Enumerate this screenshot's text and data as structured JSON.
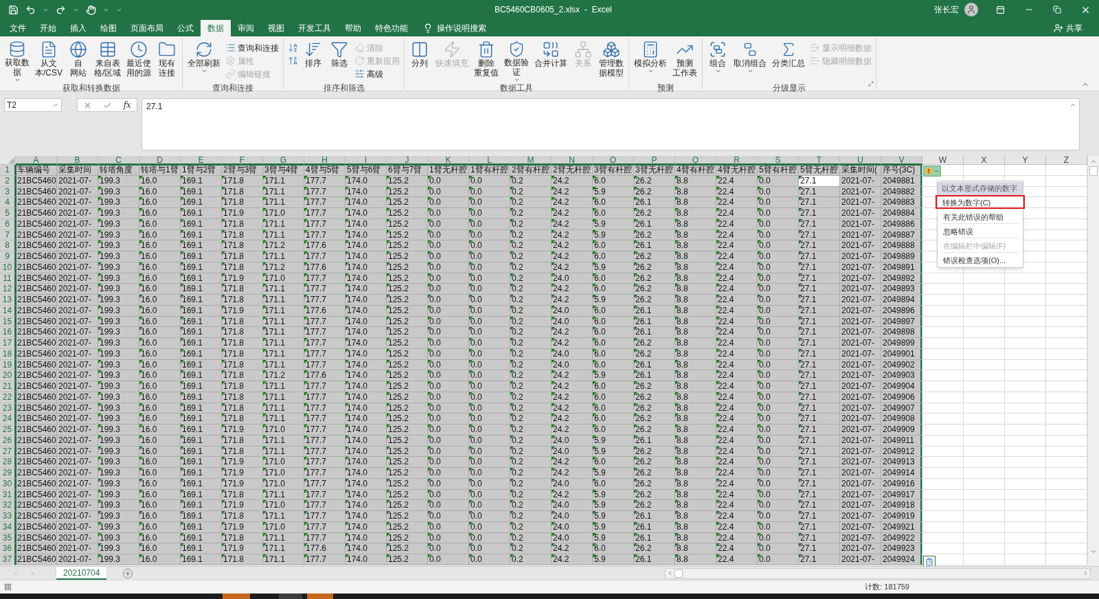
{
  "title_bar": {
    "file_title": "BC5460CB0605_2.xlsx  -  Excel",
    "user": "张长宏"
  },
  "ribbon_tabs": [
    {
      "label": "文件",
      "selected": false
    },
    {
      "label": "开始",
      "selected": false
    },
    {
      "label": "插入",
      "selected": false
    },
    {
      "label": "绘图",
      "selected": false
    },
    {
      "label": "页面布局",
      "selected": false
    },
    {
      "label": "公式",
      "selected": false
    },
    {
      "label": "数据",
      "selected": true
    },
    {
      "label": "审阅",
      "selected": false
    },
    {
      "label": "视图",
      "selected": false
    },
    {
      "label": "开发工具",
      "selected": false
    },
    {
      "label": "帮助",
      "selected": false
    },
    {
      "label": "特色功能",
      "selected": false
    }
  ],
  "tell_me": "操作说明搜索",
  "share": "共享",
  "ribbon_groups": [
    {
      "label": "获取和转换数据",
      "launcher": false,
      "buttons": [
        {
          "kind": "large",
          "lines": [
            "获取数",
            "据"
          ],
          "dropdown": true,
          "disabled": false
        },
        {
          "kind": "large",
          "lines": [
            "从文",
            "本/CSV"
          ],
          "dropdown": false,
          "disabled": false
        },
        {
          "kind": "large",
          "lines": [
            "自",
            "网站"
          ],
          "dropdown": false,
          "disabled": false
        },
        {
          "kind": "large",
          "lines": [
            "来自表",
            "格/区域"
          ],
          "dropdown": false,
          "disabled": false
        },
        {
          "kind": "large",
          "lines": [
            "最近使",
            "用的源"
          ],
          "dropdown": false,
          "disabled": false
        },
        {
          "kind": "large",
          "lines": [
            "现有",
            "连接"
          ],
          "dropdown": false,
          "disabled": false
        }
      ]
    },
    {
      "label": "查询和连接",
      "launcher": false,
      "buttons": [
        {
          "kind": "large",
          "lines": [
            "全部刷新"
          ],
          "dropdown": true,
          "disabled": false
        },
        {
          "kind": "small",
          "lines": [
            "查询和连接"
          ],
          "dropdown": false,
          "disabled": false
        },
        {
          "kind": "small",
          "lines": [
            "属性"
          ],
          "dropdown": false,
          "disabled": true
        },
        {
          "kind": "small",
          "lines": [
            "编辑链接"
          ],
          "dropdown": false,
          "disabled": true
        }
      ]
    },
    {
      "label": "排序和筛选",
      "launcher": false,
      "buttons": [
        {
          "kind": "small",
          "dropdown": false,
          "disabled": false
        },
        {
          "kind": "small",
          "dropdown": false,
          "disabled": false
        },
        {
          "kind": "large",
          "lines": [
            "排序"
          ],
          "dropdown": false,
          "disabled": false
        },
        {
          "kind": "large",
          "lines": [
            "筛选"
          ],
          "dropdown": false,
          "disabled": false
        },
        {
          "kind": "small",
          "lines": [
            "清除"
          ],
          "dropdown": false,
          "disabled": true
        },
        {
          "kind": "small",
          "lines": [
            "重新应用"
          ],
          "dropdown": false,
          "disabled": true
        },
        {
          "kind": "small",
          "lines": [
            "高级"
          ],
          "dropdown": false,
          "disabled": false
        }
      ]
    },
    {
      "label": "数据工具",
      "launcher": false,
      "buttons": [
        {
          "kind": "large",
          "lines": [
            "分列"
          ],
          "dropdown": false,
          "disabled": false
        },
        {
          "kind": "large",
          "lines": [
            "快速填充"
          ],
          "dropdown": false,
          "disabled": true
        },
        {
          "kind": "large",
          "lines": [
            "删除",
            "重复值"
          ],
          "dropdown": false,
          "disabled": false
        },
        {
          "kind": "large",
          "lines": [
            "数据验",
            "证"
          ],
          "dropdown": true,
          "disabled": false
        },
        {
          "kind": "large",
          "lines": [
            "合并计算"
          ],
          "dropdown": false,
          "disabled": false
        },
        {
          "kind": "large",
          "lines": [
            "关系"
          ],
          "dropdown": false,
          "disabled": true
        },
        {
          "kind": "large",
          "lines": [
            "管理数",
            "据模型"
          ],
          "dropdown": false,
          "disabled": false
        }
      ]
    },
    {
      "label": "预测",
      "launcher": false,
      "buttons": [
        {
          "kind": "large",
          "lines": [
            "模拟分析"
          ],
          "dropdown": true,
          "disabled": false
        },
        {
          "kind": "large",
          "lines": [
            "预测",
            "工作表"
          ],
          "dropdown": false,
          "disabled": false
        }
      ]
    },
    {
      "label": "分级显示",
      "launcher": true,
      "buttons": [
        {
          "kind": "large",
          "lines": [
            "组合"
          ],
          "dropdown": true,
          "disabled": false
        },
        {
          "kind": "large",
          "lines": [
            "取消组合"
          ],
          "dropdown": true,
          "disabled": false
        },
        {
          "kind": "large",
          "lines": [
            "分类汇总"
          ],
          "dropdown": false,
          "disabled": false
        },
        {
          "kind": "small",
          "lines": [
            "显示明细数据"
          ],
          "dropdown": false,
          "disabled": true
        },
        {
          "kind": "small",
          "lines": [
            "隐藏明细数据"
          ],
          "dropdown": false,
          "disabled": true
        }
      ]
    }
  ],
  "formula_bar": {
    "name_box": "T2",
    "function_button": "fx",
    "value": "27.1"
  },
  "grid": {
    "columns": [
      {
        "letter": "A",
        "selected": true,
        "flagged": false
      },
      {
        "letter": "B",
        "selected": true,
        "flagged": false
      },
      {
        "letter": "C",
        "selected": true,
        "flagged": true
      },
      {
        "letter": "D",
        "selected": true,
        "flagged": true
      },
      {
        "letter": "E",
        "selected": true,
        "flagged": true
      },
      {
        "letter": "F",
        "selected": true,
        "flagged": true
      },
      {
        "letter": "G",
        "selected": true,
        "flagged": true
      },
      {
        "letter": "H",
        "selected": true,
        "flagged": true
      },
      {
        "letter": "I",
        "selected": true,
        "flagged": true
      },
      {
        "letter": "J",
        "selected": true,
        "flagged": true
      },
      {
        "letter": "K",
        "selected": true,
        "flagged": true
      },
      {
        "letter": "L",
        "selected": true,
        "flagged": true
      },
      {
        "letter": "M",
        "selected": true,
        "flagged": true
      },
      {
        "letter": "N",
        "selected": true,
        "flagged": true
      },
      {
        "letter": "O",
        "selected": true,
        "flagged": true
      },
      {
        "letter": "P",
        "selected": true,
        "flagged": true
      },
      {
        "letter": "Q",
        "selected": true,
        "flagged": true
      },
      {
        "letter": "R",
        "selected": true,
        "flagged": true
      },
      {
        "letter": "S",
        "selected": true,
        "flagged": true
      },
      {
        "letter": "T",
        "selected": true,
        "flagged": true
      },
      {
        "letter": "U",
        "selected": true,
        "flagged": false
      },
      {
        "letter": "V",
        "selected": true,
        "flagged": false
      },
      {
        "letter": "W",
        "selected": false,
        "flagged": false
      },
      {
        "letter": "X",
        "selected": false,
        "flagged": false
      },
      {
        "letter": "Y",
        "selected": false,
        "flagged": false
      },
      {
        "letter": "Z",
        "selected": false,
        "flagged": false
      }
    ],
    "rows": [
      {
        "number": "1",
        "kind": "header",
        "selected": true,
        "cells": [
          "车辆编号",
          "采集时间",
          "转塔角度",
          "转塔与1臂",
          "1臂与2臂",
          "2臂与3臂",
          "3臂与4臂",
          "4臂与5臂",
          "5臂与6臂",
          "6臂与7臂",
          "1臂无杆腔",
          "1臂有杆腔",
          "2臂有杆腔",
          "2臂无杆腔",
          "3臂有杆腔",
          "3臂无杆腔",
          "4臂有杆腔",
          "4臂无杆腔",
          "5臂有杆腔",
          "5臂无杆腔",
          "采集时间(",
          "序号(3C)"
        ]
      },
      {
        "number": "2",
        "kind": "data",
        "selected": true,
        "cells": [
          "21BC5460",
          "2021-07-",
          "199.3",
          "16.0",
          "169.1",
          "171.8",
          "171.1",
          "177.7",
          "174.0",
          "125.2",
          "0.0",
          "0.0",
          "0.2",
          "24.2",
          "6.0",
          "26.2",
          "8.8",
          "22.4",
          "0.0",
          {
            "text": "27.1",
            "active": true
          },
          "2021-07-",
          "2049881"
        ]
      },
      {
        "number": "3",
        "kind": "data",
        "selected": true,
        "cells": [
          "21BC5460",
          "2021-07-",
          "199.3",
          "16.0",
          "169.1",
          "171.8",
          "171.1",
          "177.7",
          "174.0",
          "125.2",
          "0.0",
          "0.0",
          "0.2",
          "24.2",
          "5.9",
          "26.2",
          "8.8",
          "22.4",
          "0.0",
          "27.1",
          "2021-07-",
          "2049882"
        ]
      },
      {
        "number": "4",
        "kind": "data",
        "selected": true,
        "cells": [
          "21BC5460",
          "2021-07-",
          "199.3",
          "16.0",
          "169.1",
          "171.8",
          "171.1",
          "177.7",
          "174.0",
          "125.2",
          "0.0",
          "0.0",
          "0.2",
          "24.2",
          "6.0",
          "26.1",
          "8.8",
          "22.4",
          "0.0",
          "27.1",
          "2021-07-",
          "2049883"
        ]
      },
      {
        "number": "5",
        "kind": "data",
        "selected": true,
        "cells": [
          "21BC5460",
          "2021-07-",
          "199.3",
          "16.0",
          "169.1",
          "171.9",
          "171.0",
          "177.7",
          "174.0",
          "125.2",
          "0.0",
          "0.0",
          "0.2",
          "24.2",
          "6.0",
          "26.2",
          "8.8",
          "22.4",
          "0.0",
          "27.1",
          "2021-07-",
          "2049884"
        ]
      },
      {
        "number": "6",
        "kind": "data",
        "selected": true,
        "cells": [
          "21BC5460",
          "2021-07-",
          "199.3",
          "16.0",
          "169.1",
          "171.8",
          "171.1",
          "177.7",
          "174.0",
          "125.2",
          "0.0",
          "0.0",
          "0.2",
          "24.2",
          "5.9",
          "26.1",
          "8.8",
          "22.4",
          "0.0",
          "27.1",
          "2021-07-",
          "2049886"
        ]
      },
      {
        "number": "7",
        "kind": "data",
        "selected": true,
        "cells": [
          "21BC5460",
          "2021-07-",
          "199.3",
          "16.0",
          "169.1",
          "171.8",
          "171.1",
          "177.7",
          "174.0",
          "125.2",
          "0.0",
          "0.0",
          "0.2",
          "24.2",
          "5.9",
          "26.2",
          "8.8",
          "22.4",
          "0.0",
          "27.1",
          "2021-07-",
          "2049887"
        ]
      },
      {
        "number": "8",
        "kind": "data",
        "selected": true,
        "cells": [
          "21BC5460",
          "2021-07-",
          "199.3",
          "16.0",
          "169.1",
          "171.8",
          "171.2",
          "177.6",
          "174.0",
          "125.2",
          "0.0",
          "0.0",
          "0.2",
          "24.2",
          "6.0",
          "26.1",
          "8.8",
          "22.4",
          "0.0",
          "27.1",
          "2021-07-",
          "2049888"
        ]
      },
      {
        "number": "9",
        "kind": "data",
        "selected": true,
        "cells": [
          "21BC5460",
          "2021-07-",
          "199.3",
          "16.0",
          "169.1",
          "171.8",
          "171.1",
          "177.7",
          "174.0",
          "125.2",
          "0.0",
          "0.0",
          "0.2",
          "24.2",
          "6.0",
          "26.2",
          "8.8",
          "22.4",
          "0.0",
          "27.1",
          "2021-07-",
          "2049889"
        ]
      },
      {
        "number": "10",
        "kind": "data",
        "selected": true,
        "cells": [
          "21BC5460",
          "2021-07-",
          "199.3",
          "16.0",
          "169.1",
          "171.8",
          "171.2",
          "177.6",
          "174.0",
          "125.2",
          "0.0",
          "0.0",
          "0.2",
          "24.2",
          "5.9",
          "26.2",
          "8.8",
          "22.4",
          "0.0",
          "27.1",
          "2021-07-",
          "2049891"
        ]
      },
      {
        "number": "11",
        "kind": "data",
        "selected": true,
        "cells": [
          "21BC5460",
          "2021-07-",
          "199.3",
          "16.0",
          "169.1",
          "171.9",
          "171.0",
          "177.7",
          "174.0",
          "125.2",
          "0.0",
          "0.0",
          "0.2",
          "24.0",
          "6.0",
          "26.2",
          "8.8",
          "22.4",
          "0.0",
          "27.1",
          "2021-07-",
          "2049892"
        ]
      },
      {
        "number": "12",
        "kind": "data",
        "selected": true,
        "cells": [
          "21BC5460",
          "2021-07-",
          "199.3",
          "16.0",
          "169.1",
          "171.8",
          "171.1",
          "177.7",
          "174.0",
          "125.2",
          "0.0",
          "0.0",
          "0.2",
          "24.2",
          "6.0",
          "26.2",
          "8.8",
          "22.4",
          "0.0",
          "27.1",
          "2021-07-",
          "2049893"
        ]
      },
      {
        "number": "13",
        "kind": "data",
        "selected": true,
        "cells": [
          "21BC5460",
          "2021-07-",
          "199.3",
          "16.0",
          "169.1",
          "171.8",
          "171.1",
          "177.7",
          "174.0",
          "125.2",
          "0.0",
          "0.0",
          "0.2",
          "24.2",
          "5.9",
          "26.2",
          "8.8",
          "22.4",
          "0.0",
          "27.1",
          "2021-07-",
          "2049894"
        ]
      },
      {
        "number": "14",
        "kind": "data",
        "selected": true,
        "cells": [
          "21BC5460",
          "2021-07-",
          "199.3",
          "16.0",
          "169.1",
          "171.9",
          "171.1",
          "177.6",
          "174.0",
          "125.2",
          "0.0",
          "0.0",
          "0.2",
          "24.0",
          "6.0",
          "26.1",
          "8.8",
          "22.4",
          "0.0",
          "27.1",
          "2021-07-",
          "2049896"
        ]
      },
      {
        "number": "15",
        "kind": "data",
        "selected": true,
        "cells": [
          "21BC5460",
          "2021-07-",
          "199.3",
          "16.0",
          "169.1",
          "171.8",
          "171.1",
          "177.7",
          "174.0",
          "125.2",
          "0.0",
          "0.0",
          "0.2",
          "24.0",
          "6.0",
          "26.1",
          "8.8",
          "22.4",
          "0.0",
          "27.1",
          "2021-07-",
          "2049897"
        ]
      },
      {
        "number": "16",
        "kind": "data",
        "selected": true,
        "cells": [
          "21BC5460",
          "2021-07-",
          "199.3",
          "16.0",
          "169.1",
          "171.8",
          "171.1",
          "177.7",
          "174.0",
          "125.2",
          "0.0",
          "0.0",
          "0.2",
          "24.2",
          "6.0",
          "26.1",
          "8.8",
          "22.4",
          "0.0",
          "27.1",
          "2021-07-",
          "2049898"
        ]
      },
      {
        "number": "17",
        "kind": "data",
        "selected": true,
        "cells": [
          "21BC5460",
          "2021-07-",
          "199.3",
          "16.0",
          "169.1",
          "171.8",
          "171.1",
          "177.7",
          "174.0",
          "125.2",
          "0.0",
          "0.0",
          "0.2",
          "24.2",
          "6.0",
          "26.2",
          "8.8",
          "22.4",
          "0.0",
          "27.1",
          "2021-07-",
          "2049899"
        ]
      },
      {
        "number": "18",
        "kind": "data",
        "selected": true,
        "cells": [
          "21BC5460",
          "2021-07-",
          "199.3",
          "16.0",
          "169.1",
          "171.8",
          "171.1",
          "177.7",
          "174.0",
          "125.2",
          "0.0",
          "0.0",
          "0.2",
          "24.0",
          "6.0",
          "26.2",
          "8.8",
          "22.4",
          "0.0",
          "27.1",
          "2021-07-",
          "2049901"
        ]
      },
      {
        "number": "19",
        "kind": "data",
        "selected": true,
        "cells": [
          "21BC5460",
          "2021-07-",
          "199.3",
          "16.0",
          "169.1",
          "171.8",
          "171.1",
          "177.7",
          "174.0",
          "125.2",
          "0.0",
          "0.0",
          "0.2",
          "24.0",
          "6.0",
          "26.1",
          "8.8",
          "22.4",
          "0.0",
          "27.1",
          "2021-07-",
          "2049902"
        ]
      },
      {
        "number": "20",
        "kind": "data",
        "selected": true,
        "cells": [
          "21BC5460",
          "2021-07-",
          "199.3",
          "16.0",
          "169.1",
          "171.8",
          "171.2",
          "177.6",
          "174.0",
          "125.2",
          "0.0",
          "0.0",
          "0.2",
          "24.2",
          "5.9",
          "26.1",
          "8.8",
          "22.4",
          "0.0",
          "27.1",
          "2021-07-",
          "2049903"
        ]
      },
      {
        "number": "21",
        "kind": "data",
        "selected": true,
        "cells": [
          "21BC5460",
          "2021-07-",
          "199.3",
          "16.0",
          "169.1",
          "171.8",
          "171.1",
          "177.7",
          "174.0",
          "125.2",
          "0.0",
          "0.0",
          "0.2",
          "24.2",
          "6.0",
          "26.2",
          "8.8",
          "22.4",
          "0.0",
          "27.1",
          "2021-07-",
          "2049904"
        ]
      },
      {
        "number": "22",
        "kind": "data",
        "selected": true,
        "cells": [
          "21BC5460",
          "2021-07-",
          "199.3",
          "16.0",
          "169.1",
          "171.8",
          "171.1",
          "177.7",
          "174.0",
          "125.2",
          "0.0",
          "0.0",
          "0.2",
          "24.2",
          "6.0",
          "26.2",
          "8.8",
          "22.4",
          "0.0",
          "27.1",
          "2021-07-",
          "2049906"
        ]
      },
      {
        "number": "23",
        "kind": "data",
        "selected": true,
        "cells": [
          "21BC5460",
          "2021-07-",
          "199.3",
          "16.0",
          "169.1",
          "171.8",
          "171.1",
          "177.7",
          "174.0",
          "125.2",
          "0.0",
          "0.0",
          "0.2",
          "24.2",
          "6.0",
          "26.2",
          "8.8",
          "22.4",
          "0.0",
          "27.1",
          "2021-07-",
          "2049907"
        ]
      },
      {
        "number": "24",
        "kind": "data",
        "selected": true,
        "cells": [
          "21BC5460",
          "2021-07-",
          "199.3",
          "16.0",
          "169.1",
          "171.8",
          "171.1",
          "177.7",
          "174.0",
          "125.2",
          "0.0",
          "0.0",
          "0.2",
          "24.2",
          "6.0",
          "26.2",
          "8.8",
          "22.4",
          "0.0",
          "27.1",
          "2021-07-",
          "2049908"
        ]
      },
      {
        "number": "25",
        "kind": "data",
        "selected": true,
        "cells": [
          "21BC5460",
          "2021-07-",
          "199.3",
          "16.0",
          "169.1",
          "171.9",
          "171.0",
          "177.7",
          "174.0",
          "125.2",
          "0.0",
          "0.0",
          "0.2",
          "24.2",
          "6.0",
          "26.2",
          "8.8",
          "22.4",
          "0.0",
          "27.1",
          "2021-07-",
          "2049909"
        ]
      },
      {
        "number": "26",
        "kind": "data",
        "selected": true,
        "cells": [
          "21BC5460",
          "2021-07-",
          "199.3",
          "16.0",
          "169.1",
          "171.8",
          "171.1",
          "177.7",
          "174.0",
          "125.2",
          "0.0",
          "0.0",
          "0.2",
          "24.0",
          "5.9",
          "26.1",
          "8.8",
          "22.4",
          "0.0",
          "27.1",
          "2021-07-",
          "2049911"
        ]
      },
      {
        "number": "27",
        "kind": "data",
        "selected": true,
        "cells": [
          "21BC5460",
          "2021-07-",
          "199.3",
          "16.0",
          "169.1",
          "171.8",
          "171.1",
          "177.7",
          "174.0",
          "125.2",
          "0.0",
          "0.0",
          "0.2",
          "24.0",
          "5.9",
          "26.2",
          "8.8",
          "22.4",
          "0.0",
          "27.1",
          "2021-07-",
          "2049912"
        ]
      },
      {
        "number": "28",
        "kind": "data",
        "selected": true,
        "cells": [
          "21BC5460",
          "2021-07-",
          "199.3",
          "16.0",
          "169.1",
          "171.9",
          "171.0",
          "177.7",
          "174.0",
          "125.2",
          "0.0",
          "0.0",
          "0.2",
          "24.2",
          "6.0",
          "26.2",
          "8.8",
          "22.4",
          "0.0",
          "27.1",
          "2021-07-",
          "2049913"
        ]
      },
      {
        "number": "29",
        "kind": "data",
        "selected": true,
        "cells": [
          "21BC5460",
          "2021-07-",
          "199.3",
          "16.0",
          "169.1",
          "171.9",
          "171.0",
          "177.7",
          "174.0",
          "125.2",
          "0.0",
          "0.0",
          "0.2",
          "24.2",
          "5.9",
          "26.2",
          "8.8",
          "22.4",
          "0.0",
          "27.1",
          "2021-07-",
          "2049914"
        ]
      },
      {
        "number": "30",
        "kind": "data",
        "selected": true,
        "cells": [
          "21BC5460",
          "2021-07-",
          "199.3",
          "16.0",
          "169.1",
          "171.9",
          "171.0",
          "177.7",
          "174.0",
          "125.2",
          "0.0",
          "0.0",
          "0.2",
          "24.0",
          "6.0",
          "26.2",
          "8.8",
          "22.4",
          "0.0",
          "27.1",
          "2021-07-",
          "2049916"
        ]
      },
      {
        "number": "31",
        "kind": "data",
        "selected": true,
        "cells": [
          "21BC5460",
          "2021-07-",
          "199.3",
          "16.0",
          "169.1",
          "171.8",
          "171.1",
          "177.7",
          "174.0",
          "125.2",
          "0.0",
          "0.0",
          "0.2",
          "24.2",
          "5.9",
          "26.2",
          "8.8",
          "22.4",
          "0.0",
          "27.1",
          "2021-07-",
          "2049917"
        ]
      },
      {
        "number": "32",
        "kind": "data",
        "selected": true,
        "cells": [
          "21BC5460",
          "2021-07-",
          "199.3",
          "16.0",
          "169.1",
          "171.9",
          "171.0",
          "177.7",
          "174.0",
          "125.2",
          "0.0",
          "0.0",
          "0.2",
          "24.0",
          "5.9",
          "26.2",
          "8.8",
          "22.4",
          "0.0",
          "27.1",
          "2021-07-",
          "2049918"
        ]
      },
      {
        "number": "33",
        "kind": "data",
        "selected": true,
        "cells": [
          "21BC5460",
          "2021-07-",
          "199.3",
          "16.0",
          "169.1",
          "171.8",
          "171.1",
          "177.7",
          "174.0",
          "125.2",
          "0.0",
          "0.0",
          "0.2",
          "24.0",
          "5.9",
          "26.1",
          "8.8",
          "22.4",
          "0.0",
          "27.1",
          "2021-07-",
          "2049919"
        ]
      },
      {
        "number": "34",
        "kind": "data",
        "selected": true,
        "cells": [
          "21BC5460",
          "2021-07-",
          "199.3",
          "16.0",
          "169.1",
          "171.9",
          "171.0",
          "177.7",
          "174.0",
          "125.2",
          "0.0",
          "0.0",
          "0.2",
          "24.0",
          "5.9",
          "26.1",
          "8.8",
          "22.4",
          "0.0",
          "27.1",
          "2021-07-",
          "2049921"
        ]
      },
      {
        "number": "35",
        "kind": "data",
        "selected": true,
        "cells": [
          "21BC5460",
          "2021-07-",
          "199.3",
          "16.0",
          "169.1",
          "171.8",
          "171.1",
          "177.7",
          "174.0",
          "125.2",
          "0.0",
          "0.0",
          "0.2",
          "24.0",
          "5.9",
          "26.1",
          "8.8",
          "22.4",
          "0.0",
          "27.1",
          "2021-07-",
          "2049922"
        ]
      },
      {
        "number": "36",
        "kind": "data",
        "selected": true,
        "cells": [
          "21BC5460",
          "2021-07-",
          "199.3",
          "16.0",
          "169.1",
          "171.9",
          "171.1",
          "177.6",
          "174.0",
          "125.2",
          "0.0",
          "0.0",
          "0.2",
          "24.2",
          "6.0",
          "26.2",
          "8.8",
          "22.4",
          "0.0",
          "27.1",
          "2021-07-",
          "2049923"
        ]
      },
      {
        "number": "37",
        "kind": "data",
        "selected": true,
        "cells": [
          "21BC5460",
          "2021-07-",
          "199.3",
          "16.0",
          "169.1",
          "171.8",
          "171.1",
          "177.7",
          "174.0",
          "125.2",
          "0.0",
          "0.0",
          "0.2",
          "24.2",
          "5.9",
          "26.1",
          "8.8",
          "22.4",
          "0.0",
          "27.1",
          "2021-07-",
          "2049924"
        ]
      }
    ]
  },
  "error_menu": {
    "title": "以文本形式存储的数字",
    "items": [
      {
        "label": "转换为数字(C)",
        "disabled": false,
        "highlighted": true
      },
      {
        "label": "有关此错误的帮助",
        "disabled": false,
        "highlighted": false
      },
      {
        "label": "忽略错误",
        "disabled": false,
        "highlighted": false
      },
      {
        "label": "在编辑栏中编辑(F)",
        "disabled": true,
        "highlighted": false
      },
      {
        "label": "错误检查选项(O)...",
        "disabled": false,
        "highlighted": false
      }
    ]
  },
  "sheet_tabs": [
    {
      "label": "20210704",
      "selected": true
    }
  ],
  "status_bar": {
    "text": "计数: 181759"
  }
}
